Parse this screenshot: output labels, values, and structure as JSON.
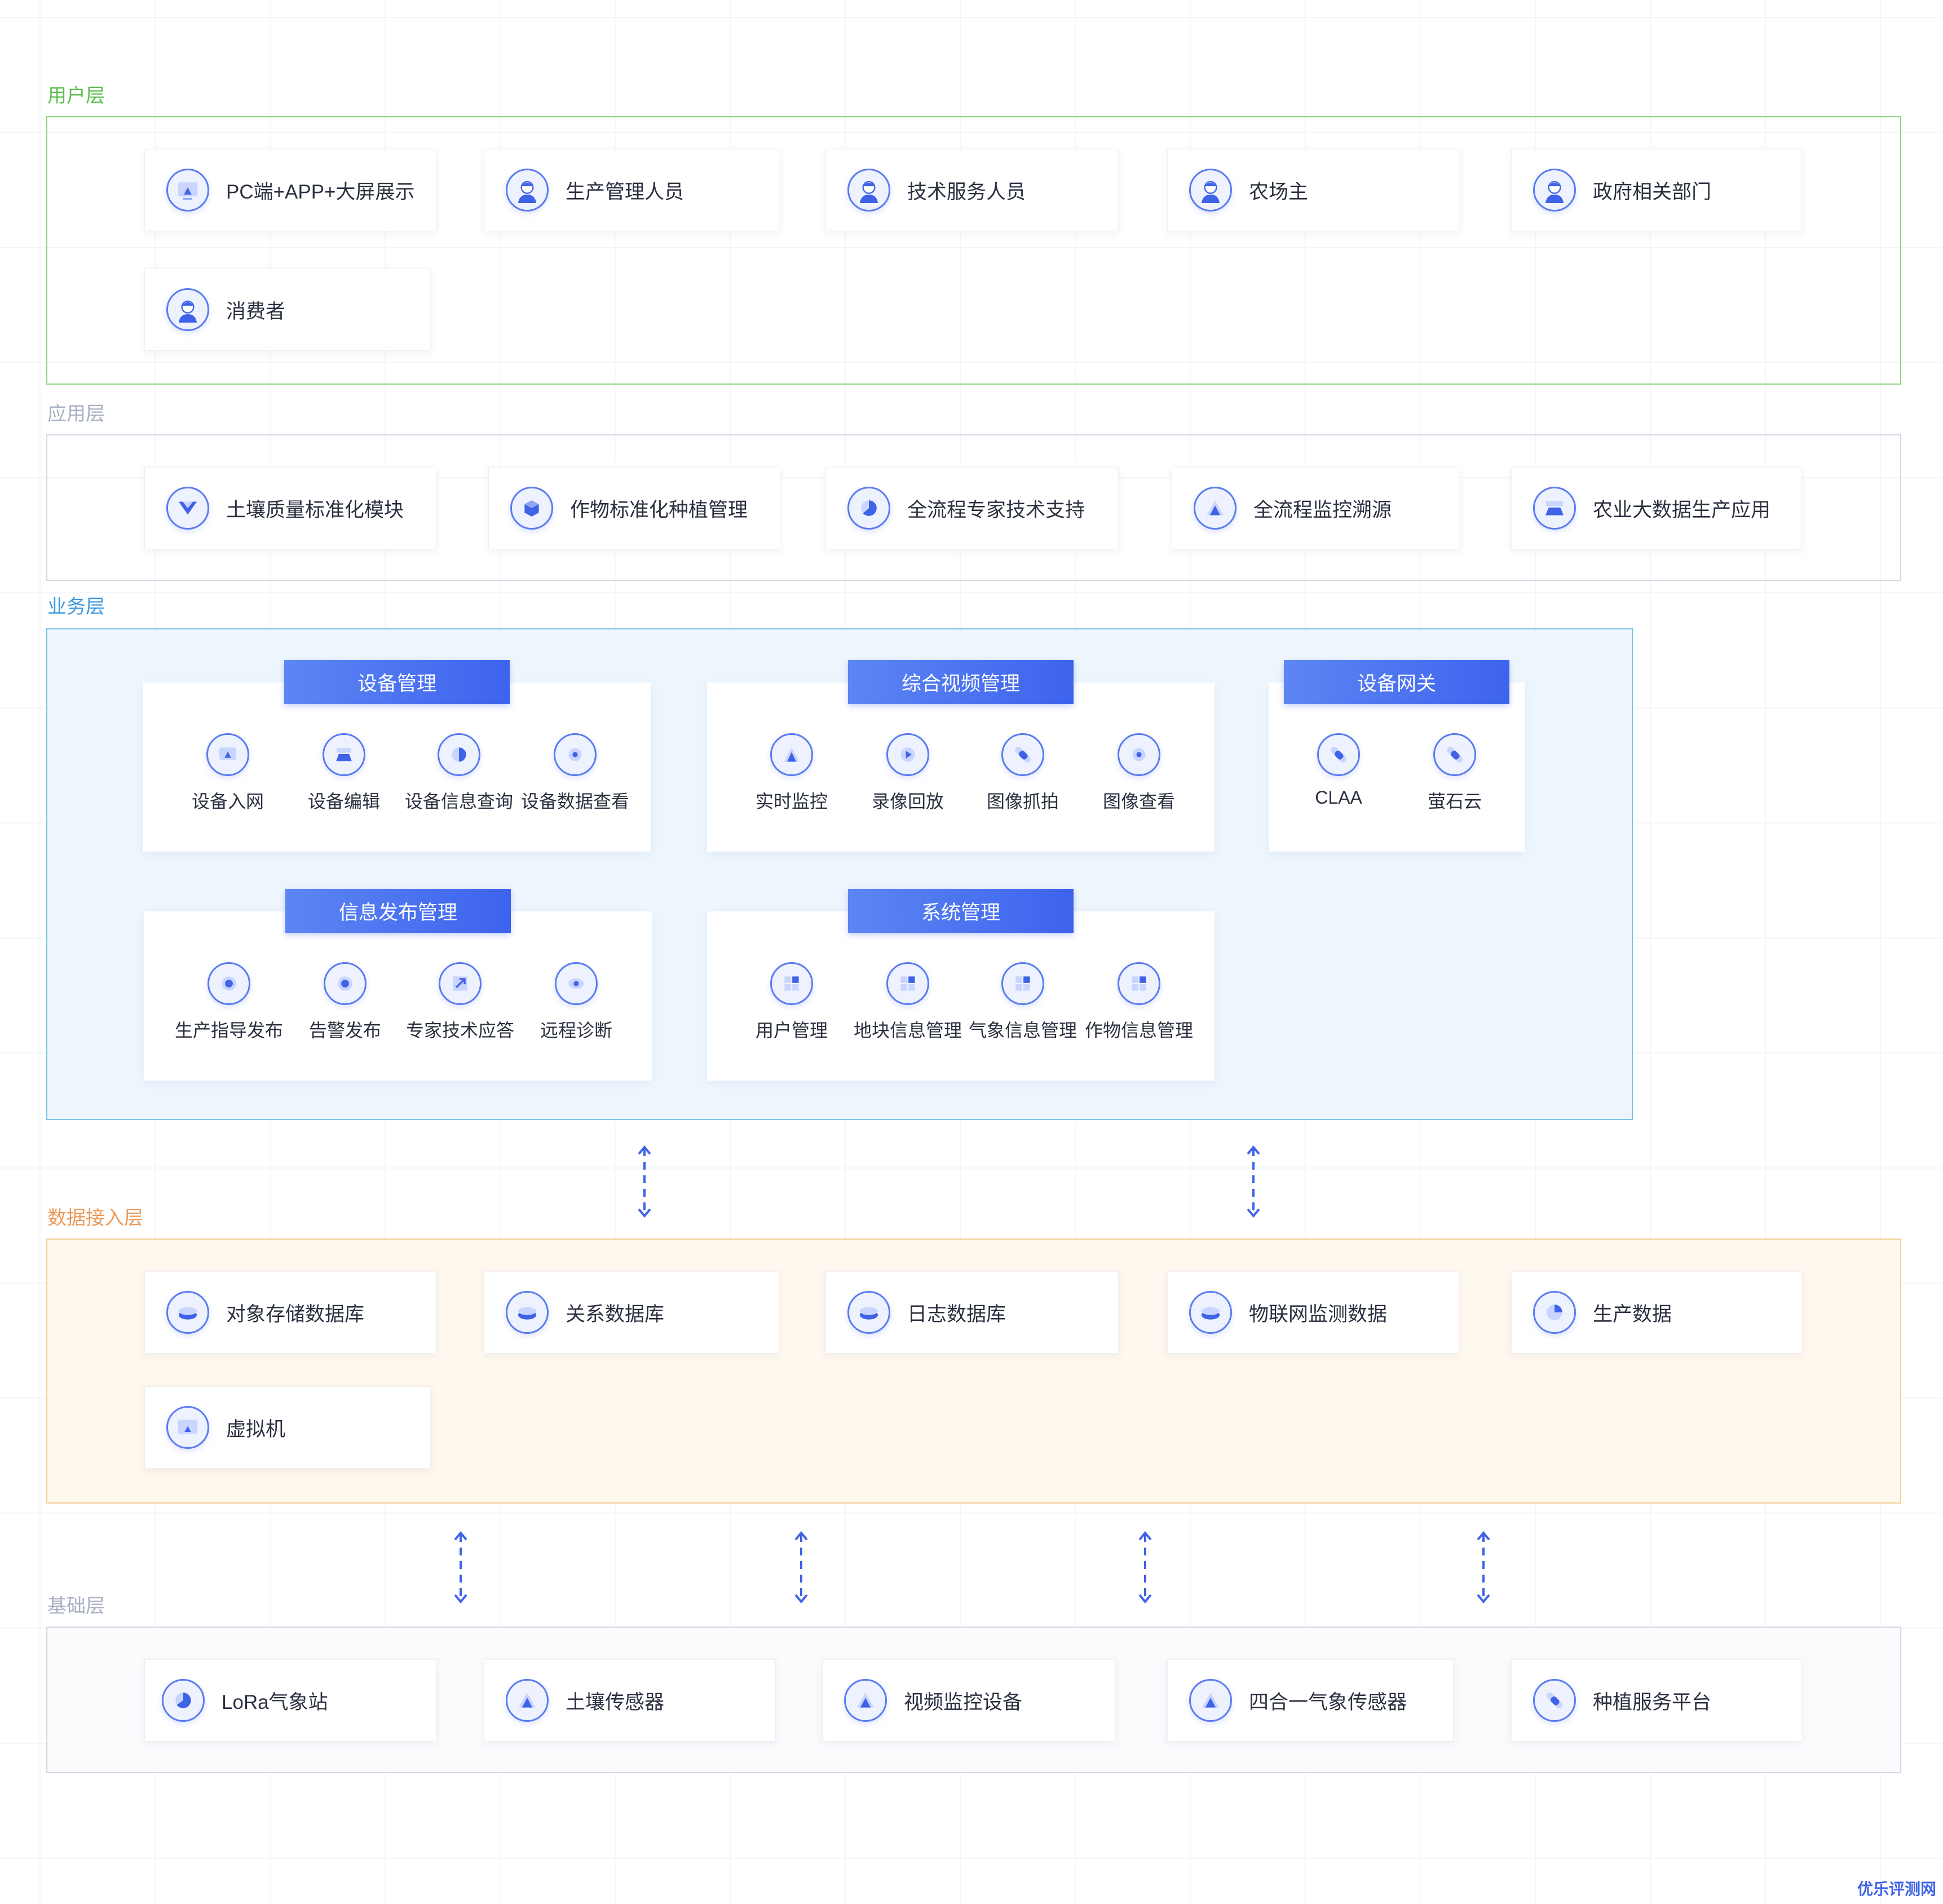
{
  "colors": {
    "user": "#5cbf4f",
    "app": "#a8b0c2",
    "biz": "#3d9ae0",
    "data": "#ea9a5a",
    "base": "#a8b0c2",
    "accent": "#3f63e6"
  },
  "layers": {
    "user": {
      "title": "用户层",
      "items": [
        {
          "label": "PC端+APP+大屏展示",
          "icon": "monitor-icon"
        },
        {
          "label": "生产管理人员",
          "icon": "person-icon"
        },
        {
          "label": "技术服务人员",
          "icon": "person-icon"
        },
        {
          "label": "农场主",
          "icon": "person-icon"
        },
        {
          "label": "政府相关部门",
          "icon": "person-icon"
        },
        {
          "label": "消费者",
          "icon": "person-icon"
        }
      ]
    },
    "app": {
      "title": "应用层",
      "items": [
        {
          "label": "土壤质量标准化模块",
          "icon": "funnel-icon"
        },
        {
          "label": "作物标准化种植管理",
          "icon": "cube-icon"
        },
        {
          "label": "全流程专家技术支持",
          "icon": "pie-icon"
        },
        {
          "label": "全流程监控溯源",
          "icon": "triangle-icon"
        },
        {
          "label": "农业大数据生产应用",
          "icon": "trapezoid-icon"
        }
      ]
    },
    "biz": {
      "title": "业务层",
      "panels": [
        {
          "title": "设备管理",
          "items": [
            "设备入网",
            "设备编辑",
            "设备信息查询",
            "设备数据查看"
          ]
        },
        {
          "title": "综合视频管理",
          "items": [
            "实时监控",
            "录像回放",
            "图像抓拍",
            "图像查看"
          ]
        },
        {
          "title": "设备网关",
          "items": [
            "CLAA",
            "萤石云"
          ]
        },
        {
          "title": "信息发布管理",
          "items": [
            "生产指导发布",
            "告警发布",
            "专家技术应答",
            "远程诊断"
          ]
        },
        {
          "title": "系统管理",
          "items": [
            "用户管理",
            "地块信息管理",
            "气象信息管理",
            "作物信息管理"
          ]
        }
      ]
    },
    "data": {
      "title": "数据接入层",
      "items": [
        {
          "label": "对象存储数据库",
          "icon": "database-icon"
        },
        {
          "label": "关系数据库",
          "icon": "database-icon"
        },
        {
          "label": "日志数据库",
          "icon": "database-icon"
        },
        {
          "label": "物联网监测数据",
          "icon": "database-icon"
        },
        {
          "label": "生产数据",
          "icon": "pie-icon"
        },
        {
          "label": "虚拟机",
          "icon": "monitor-icon"
        }
      ]
    },
    "base": {
      "title": "基础层",
      "items": [
        {
          "label": "LoRa气象站",
          "icon": "pie-icon"
        },
        {
          "label": "土壤传感器",
          "icon": "triangle-icon"
        },
        {
          "label": "视频监控设备",
          "icon": "triangle-icon"
        },
        {
          "label": "四合一气象传感器",
          "icon": "triangle-icon"
        },
        {
          "label": "种植服务平台",
          "icon": "capsule-icon"
        }
      ]
    }
  },
  "watermark": "优乐评测网"
}
